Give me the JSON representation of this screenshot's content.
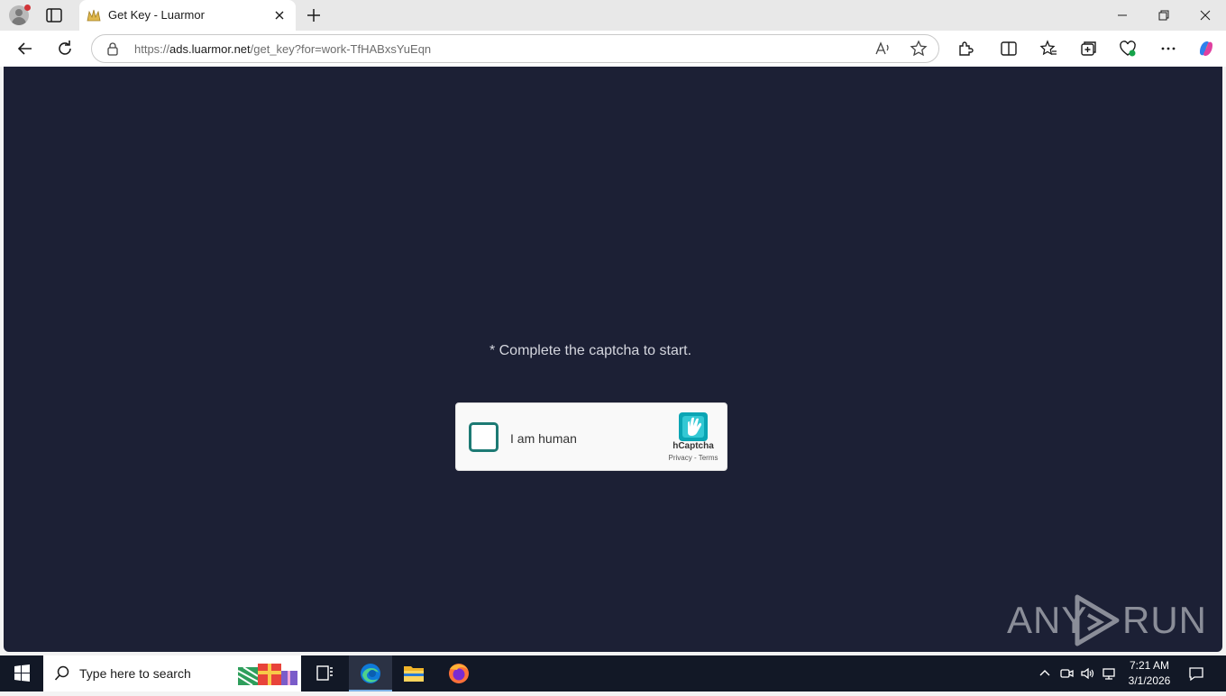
{
  "browser": {
    "tab": {
      "title": "Get Key - Luarmor"
    },
    "address": {
      "scheme": "https://",
      "host": "ads.luarmor.net",
      "path": "/get_key?for=work-TfHABxsYuEqn"
    },
    "window_buttons": [
      "minimize-icon",
      "restore-icon",
      "close-icon"
    ]
  },
  "page": {
    "background_color": "#1c2035",
    "instruction": "* Complete the captcha to start.",
    "captcha": {
      "label": "I am human",
      "brand": "hCaptcha",
      "links": "Privacy - Terms",
      "checked": false
    },
    "watermark": {
      "left": "ANY",
      "right": "RUN"
    }
  },
  "taskbar": {
    "search_placeholder": "Type here to search",
    "apps": [
      "task-view-icon",
      "edge-icon",
      "file-explorer-icon",
      "firefox-icon"
    ],
    "active_app": "edge-icon",
    "clock": {
      "time": "7:21 AM",
      "date": "3/1/2026"
    }
  }
}
